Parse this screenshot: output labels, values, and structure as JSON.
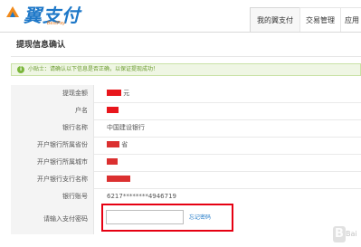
{
  "header": {
    "logo_text": "翼支付",
    "logo_sub": "BestPay",
    "tabs": [
      {
        "label": "我的翼支付",
        "active": true
      },
      {
        "label": "交易管理",
        "active": false
      },
      {
        "label": "应用",
        "active": false
      }
    ]
  },
  "page_title": "提现信息确认",
  "tip": {
    "icon": "i",
    "text": "小贴士：请确认以下信息是否正确，以保证提现成功！"
  },
  "rows": [
    {
      "label": "提现金额",
      "value_suffix": "元"
    },
    {
      "label": "户名"
    },
    {
      "label": "银行名称",
      "value": "中国建设银行"
    },
    {
      "label": "开户银行所属省份",
      "value_suffix": "省"
    },
    {
      "label": "开户银行所属城市"
    },
    {
      "label": "开户银行支行名称"
    },
    {
      "label": "银行账号",
      "value": "6217********4946719"
    }
  ],
  "password": {
    "label": "请输入支付密码",
    "forgot": "忘记密码"
  },
  "watermark": "Bai"
}
